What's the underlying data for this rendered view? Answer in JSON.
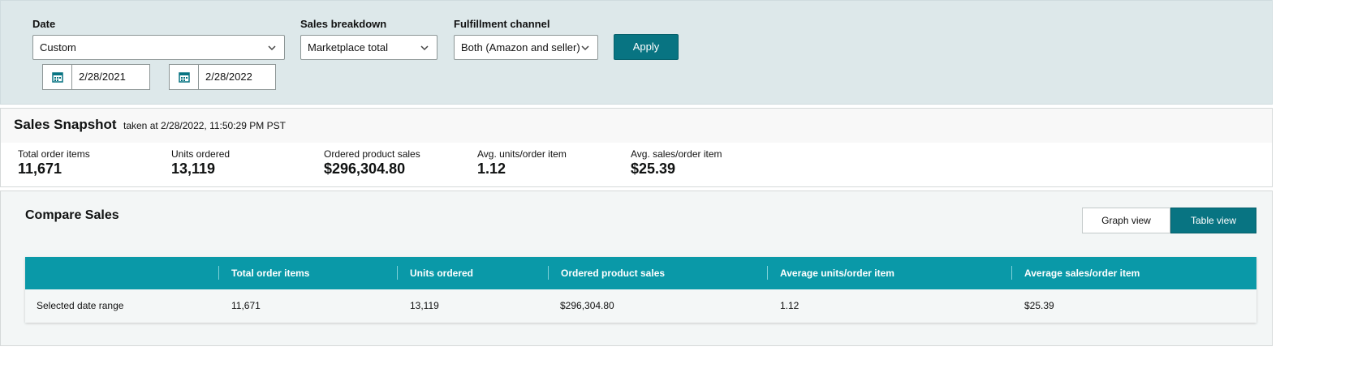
{
  "filters": {
    "date": {
      "label": "Date",
      "value": "Custom"
    },
    "sales_breakdown": {
      "label": "Sales breakdown",
      "value": "Marketplace total"
    },
    "fulfillment": {
      "label": "Fulfillment channel",
      "value": "Both (Amazon and seller)"
    },
    "apply_label": "Apply",
    "start_date": "2/28/2021",
    "end_date": "2/28/2022",
    "calendar_icon": "calendar-icon",
    "chevron_icon": "chevron-down-icon"
  },
  "snapshot": {
    "title": "Sales Snapshot",
    "taken": "taken at 2/28/2022, 11:50:29 PM PST",
    "metrics": [
      {
        "label": "Total order items",
        "value": "11,671"
      },
      {
        "label": "Units ordered",
        "value": "13,119"
      },
      {
        "label": "Ordered product sales",
        "value": "$296,304.80"
      },
      {
        "label": "Avg. units/order item",
        "value": "1.12"
      },
      {
        "label": "Avg. sales/order item",
        "value": "$25.39"
      }
    ]
  },
  "compare": {
    "title": "Compare Sales",
    "graph_view_label": "Graph view",
    "table_view_label": "Table view",
    "columns": [
      "",
      "Total order items",
      "Units ordered",
      "Ordered product sales",
      "Average units/order item",
      "Average sales/order item"
    ],
    "rows": [
      [
        "Selected date range",
        "11,671",
        "13,119",
        "$296,304.80",
        "1.12",
        "$25.39"
      ]
    ]
  },
  "colors": {
    "accent": "#087482",
    "table_header": "#0a99a8",
    "filter_bg": "#dde8ea"
  }
}
